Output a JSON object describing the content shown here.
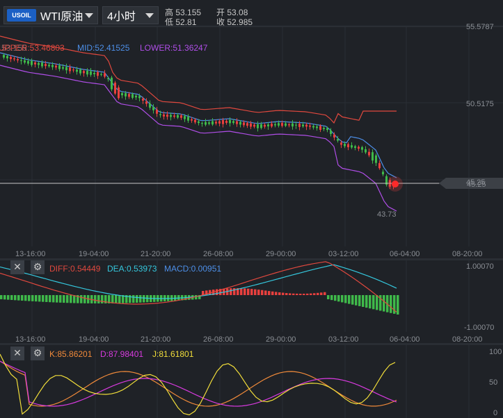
{
  "header": {
    "symbol_badge": "USOIL",
    "symbol_name": "WTI原油",
    "period": "4小时",
    "high_label": "高",
    "high": "53.155",
    "low_label": "低",
    "low": "52.81",
    "open_label": "开",
    "open": "53.08",
    "close_label": "收",
    "close": "52.985"
  },
  "main_chart": {
    "indicator_up": "UPPER:53.46803",
    "indicator_mid": "MID:52.41525",
    "indicator_low": "LOWER:51.36247",
    "overlap_price": "53.155",
    "price_ticks": [
      "55.5787",
      "50.5175",
      "45.25"
    ],
    "last_price": "45.25",
    "low_marker": "43.73"
  },
  "time_axis": [
    "13-16:00",
    "19-04:00",
    "21-20:00",
    "26-08:00",
    "29-00:00",
    "03-12:00",
    "06-04:00",
    "08-20:00"
  ],
  "macd_panel": {
    "diff": "DIFF:0.54449",
    "dea": "DEA:0.53973",
    "macd": "MACD:0.00951",
    "top_tick": "1.00070",
    "bottom_tick": "-1.00070"
  },
  "kdj_panel": {
    "k": "K:85.86201",
    "d": "D:87.98401",
    "j": "J:81.61801",
    "ticks": [
      "100",
      "50",
      "0"
    ]
  },
  "colors": {
    "up": "#e8403e",
    "down": "#3fb94a",
    "upper_band": "#e0483e",
    "mid_band": "#4d8fe8",
    "lower_band": "#b04ee8",
    "dea_line": "#35c8de",
    "k_line": "#f08a3a",
    "d_line": "#d83adf",
    "j_line": "#f2de3a"
  },
  "icons": {
    "close": "close-icon",
    "settings": "gear-icon"
  }
}
